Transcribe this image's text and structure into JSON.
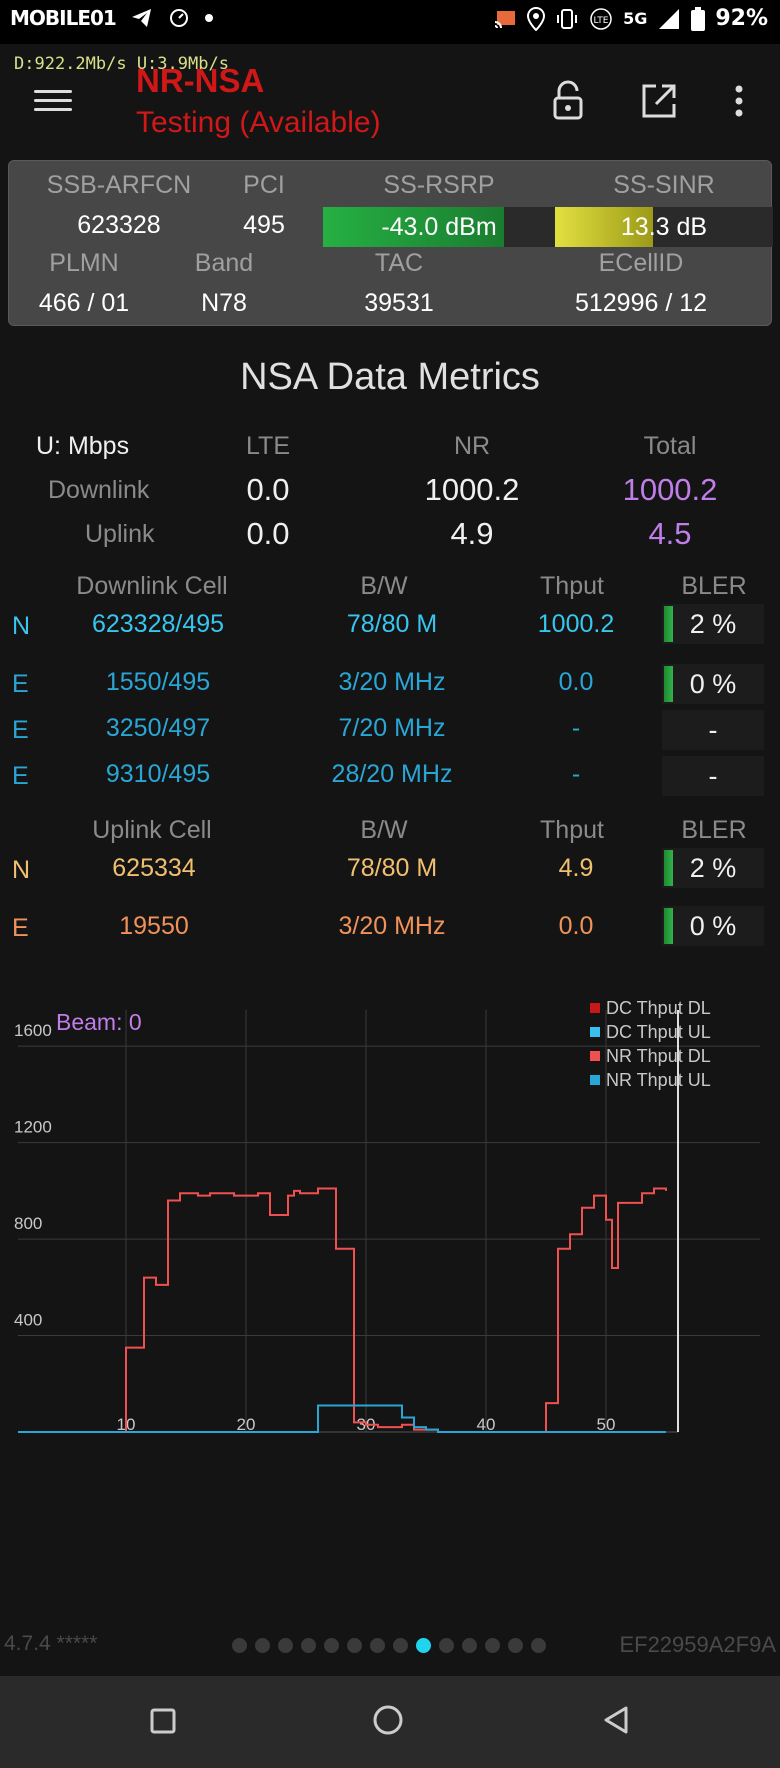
{
  "status_bar": {
    "brand": "MOBILE01",
    "network_badge": "5G",
    "battery": "92%",
    "icons": [
      "bell-off-icon",
      "telegram-icon",
      "speed-icon",
      "dot-icon",
      "cast-icon",
      "location-icon",
      "vibrate-icon",
      "volte-icon",
      "signal-icon",
      "battery-icon"
    ]
  },
  "app_bar": {
    "speed": "D:922.2Mb/s  U:3.9Mb/s",
    "title": "NR-NSA",
    "subtitle": "Testing (Available)",
    "icons": [
      "menu-icon",
      "unlock-icon",
      "share-icon",
      "more-vert-icon"
    ]
  },
  "cell_info": {
    "labels": {
      "arfcn": "SSB-ARFCN",
      "pci": "PCI",
      "rsrp": "SS-RSRP",
      "sinr": "SS-SINR",
      "plmn": "PLMN",
      "band": "Band",
      "tac": "TAC",
      "ecellid": "ECellID"
    },
    "arfcn": "623328",
    "pci": "495",
    "rsrp": "-43.0 dBm",
    "rsrp_level": 0.78,
    "sinr": "13.3 dB",
    "sinr_level": 0.45,
    "plmn": "466 / 01",
    "band": "N78",
    "tac": "39531",
    "ecellid": "512996 / 12",
    "colors": {
      "rsrp": "#26b043",
      "sinr": "#e2e040"
    }
  },
  "metrics": {
    "title": "NSA Data Metrics",
    "unit": "U: Mbps",
    "col_lte": "LTE",
    "col_nr": "NR",
    "col_total": "Total",
    "downlink_label": "Downlink",
    "uplink_label": "Uplink",
    "downlink": {
      "lte": "0.0",
      "nr": "1000.2",
      "total": "1000.2"
    },
    "uplink": {
      "lte": "0.0",
      "nr": "4.9",
      "total": "4.5"
    }
  },
  "downlink_cells": {
    "headers": {
      "cell": "Downlink Cell",
      "bw": "B/W",
      "thput": "Thput",
      "bler": "BLER"
    },
    "rows": [
      {
        "type": "N",
        "cell": "623328/495",
        "bw": "78/80 M",
        "thput": "1000.2",
        "bler": "2 %"
      },
      {
        "type": "E",
        "cell": "1550/495",
        "bw": "3/20 MHz",
        "thput": "0.0",
        "bler": "0 %"
      },
      {
        "type": "E",
        "cell": "3250/497",
        "bw": "7/20 MHz",
        "thput": "-",
        "bler": "-"
      },
      {
        "type": "E",
        "cell": "9310/495",
        "bw": "28/20 MHz",
        "thput": "-",
        "bler": "-"
      }
    ]
  },
  "uplink_cells": {
    "headers": {
      "cell": "Uplink Cell",
      "bw": "B/W",
      "thput": "Thput",
      "bler": "BLER"
    },
    "rows": [
      {
        "type": "N",
        "cell": "625334",
        "bw": "78/80 M",
        "thput": "4.9",
        "bler": "2 %"
      },
      {
        "type": "E",
        "cell": "19550",
        "bw": "3/20 MHz",
        "thput": "0.0",
        "bler": "0 %"
      }
    ]
  },
  "chart_data": {
    "type": "line",
    "annotation": "Beam: 0",
    "x_ticks": [
      "10",
      "20",
      "30",
      "40",
      "50"
    ],
    "y_ticks": [
      "400",
      "800",
      "1200",
      "1600"
    ],
    "xlim": [
      1,
      56
    ],
    "ylim": [
      0,
      1750
    ],
    "grid": true,
    "legend_position": "top-right",
    "series": [
      {
        "name": "DC Thput DL",
        "color": "#c81818",
        "x": [],
        "y": []
      },
      {
        "name": "DC Thput UL",
        "color": "#3ac0f0",
        "x": [],
        "y": []
      },
      {
        "name": "NR Thput DL",
        "color": "#f05050",
        "x": [
          1,
          8,
          10,
          10.5,
          11.5,
          12.5,
          13.5,
          14.5,
          16,
          17,
          19,
          21,
          22,
          23.5,
          24,
          24.5,
          26,
          27.5,
          29,
          30,
          31,
          33,
          34,
          36,
          38,
          45,
          46,
          47,
          48,
          49,
          50,
          50.5,
          51,
          52,
          53,
          54,
          55
        ],
        "y": [
          0,
          0,
          350,
          350,
          640,
          610,
          960,
          990,
          980,
          990,
          980,
          990,
          900,
          980,
          1000,
          990,
          1010,
          760,
          40,
          30,
          20,
          30,
          10,
          0,
          0,
          120,
          760,
          820,
          930,
          980,
          880,
          680,
          950,
          950,
          990,
          1010,
          1000
        ]
      },
      {
        "name": "NR Thput UL",
        "color": "#2aa6d6",
        "x": [
          1,
          9,
          22,
          26,
          27,
          28,
          29,
          32,
          33,
          34,
          35,
          36,
          37,
          46,
          55
        ],
        "y": [
          0,
          0,
          0,
          110,
          110,
          110,
          110,
          110,
          60,
          20,
          10,
          0,
          0,
          0,
          0
        ]
      }
    ]
  },
  "footer": {
    "version": "4.7.4 *****",
    "device_id": "EF22959A2F9A",
    "page_count": 14,
    "active_page": 8
  },
  "nav_bar": {
    "icons": [
      "recents-icon",
      "home-icon",
      "back-icon"
    ]
  }
}
